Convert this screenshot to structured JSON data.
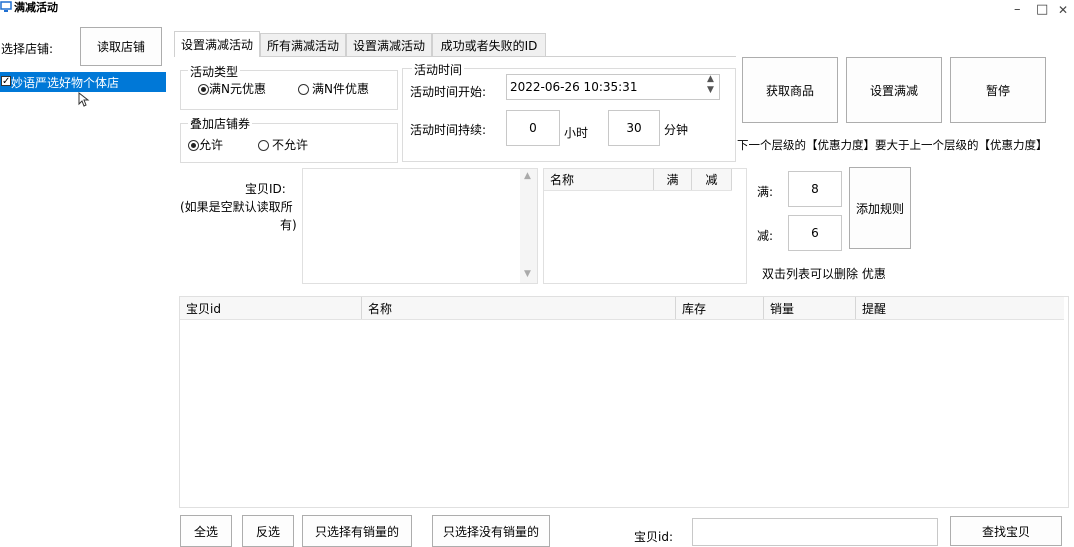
{
  "window": {
    "title": "满减活动",
    "minimize": "–",
    "maximize": "□",
    "close": "✕"
  },
  "shop": {
    "select_label": "选择店铺:",
    "read_button": "读取店铺",
    "items": [
      {
        "label": "妙语严选好物个体店",
        "checked": true
      }
    ]
  },
  "tabs": [
    {
      "label": "设置满减活动"
    },
    {
      "label": "所有满减活动"
    },
    {
      "label": "设置满减活动"
    },
    {
      "label": "成功或者失败的ID"
    }
  ],
  "activity_type": {
    "title": "活动类型",
    "options": [
      {
        "label": "满N元优惠",
        "selected": true
      },
      {
        "label": "满N件优惠",
        "selected": false
      }
    ]
  },
  "coupon": {
    "title": "叠加店铺券",
    "options": [
      {
        "label": "允许",
        "selected": true
      },
      {
        "label": "不允许",
        "selected": false
      }
    ]
  },
  "activity_time": {
    "title": "活动时间",
    "start_label": "活动时间开始:",
    "start_value": "2022-06-26 10:35:31",
    "duration_label": "活动时间持续:",
    "hours_value": "0",
    "hours_unit": "小时",
    "minutes_value": "30",
    "minutes_unit": "分钟"
  },
  "actions": {
    "get_goods": "获取商品",
    "set_discount": "设置满减",
    "pause": "暂停"
  },
  "notice": "下一个层级的【优惠力度】要大于上一个层级的【优惠力度】",
  "item_id": {
    "label_line1": "宝贝ID:",
    "label_line2": "(如果是空默认读取所",
    "label_line3": "有)"
  },
  "rules": {
    "columns": [
      "名称",
      "满",
      "减"
    ],
    "full_label": "满:",
    "full_value": "8",
    "reduce_label": "减:",
    "reduce_value": "6",
    "add_button": "添加规则",
    "hint": "双击列表可以删除 优惠"
  },
  "goods_table": {
    "columns": [
      "宝贝id",
      "名称",
      "库存",
      "销量",
      "提醒"
    ],
    "rows": []
  },
  "bottom": {
    "select_all": "全选",
    "invert": "反选",
    "only_with_sales": "只选择有销量的",
    "only_without_sales": "只选择没有销量的",
    "id_label": "宝贝id:",
    "id_value": "",
    "find_button": "查找宝贝"
  },
  "colors": {
    "selection": "#0078d7",
    "app_icon": "#1f6fd1"
  }
}
